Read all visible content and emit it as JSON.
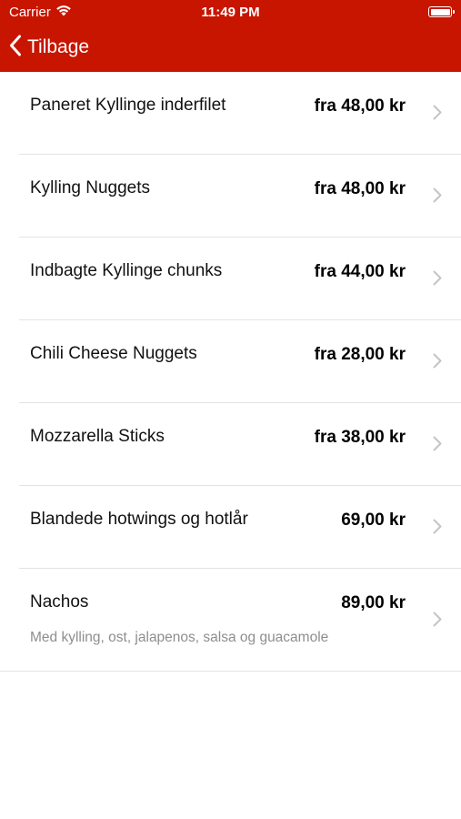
{
  "status_bar": {
    "carrier": "Carrier",
    "time": "11:49 PM",
    "icons": [
      "wifi-icon",
      "battery-icon"
    ]
  },
  "nav": {
    "back_label": "Tilbage",
    "back_icon": "chevron-left-icon",
    "bar_color": "#c81500"
  },
  "items": [
    {
      "name": "Paneret Kyllinge inderfilet",
      "price": "fra 48,00 kr"
    },
    {
      "name": "Kylling Nuggets",
      "price": "fra 48,00 kr"
    },
    {
      "name": "Indbagte Kyllinge chunks",
      "price": "fra 44,00 kr"
    },
    {
      "name": "Chili Cheese Nuggets",
      "price": "fra 28,00 kr"
    },
    {
      "name": "Mozzarella Sticks",
      "price": "fra 38,00 kr"
    },
    {
      "name": "Blandede hotwings og hotlår",
      "price": "69,00 kr"
    },
    {
      "name": "Nachos",
      "price": "89,00 kr",
      "description": "Med kylling, ost, jalapenos, salsa og guacamole"
    }
  ],
  "row_icon": "chevron-right-icon"
}
